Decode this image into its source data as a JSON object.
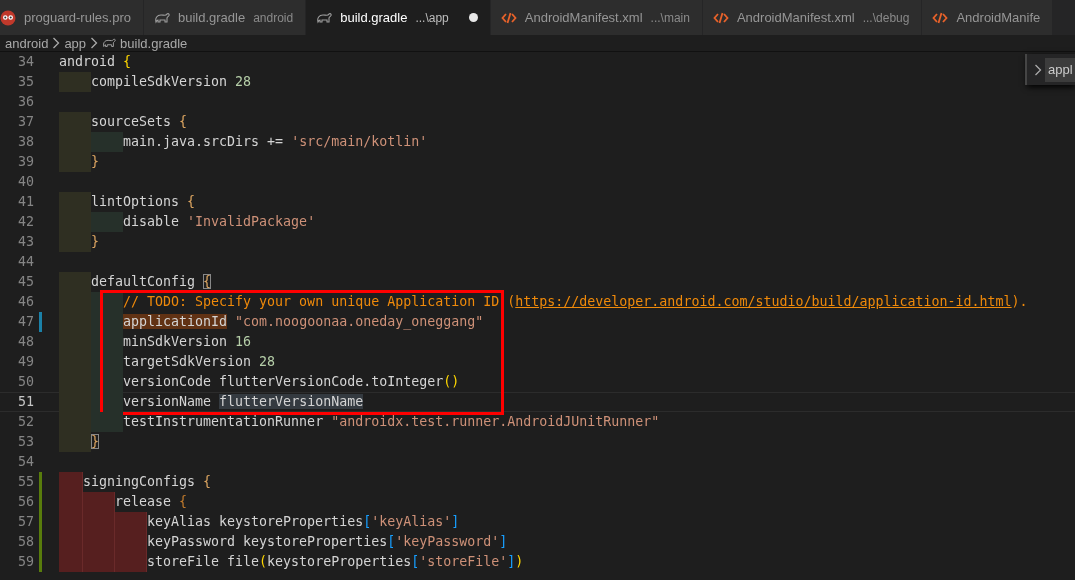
{
  "tabs": [
    {
      "label": "proguard-rules.pro",
      "kind": "proguard",
      "selected": false,
      "dirty": false
    },
    {
      "label": "build.gradle",
      "description": "android",
      "kind": "gradle",
      "selected": false,
      "dirty": false
    },
    {
      "label": "build.gradle",
      "description": "...\\app",
      "kind": "gradle",
      "selected": true,
      "dirty": true
    },
    {
      "label": "AndroidManifest.xml",
      "description": "...\\main",
      "kind": "markup",
      "selected": false,
      "dirty": false
    },
    {
      "label": "AndroidManifest.xml",
      "description": "...\\debug",
      "kind": "markup",
      "selected": false,
      "dirty": false
    },
    {
      "label": "AndroidManife",
      "kind": "markup",
      "selected": false,
      "dirty": false
    }
  ],
  "breadcrumb": [
    {
      "label": "android",
      "kind": "folder"
    },
    {
      "label": "app",
      "kind": "folder"
    },
    {
      "label": "build.gradle",
      "kind": "gradle"
    }
  ],
  "find_widget": {
    "value": "appl"
  },
  "lines": [
    {
      "number": "34",
      "current": false,
      "modified": false,
      "added": false,
      "boxed": false,
      "tokens": [
        {
          "text": "android ",
          "kind": "plain"
        },
        {
          "text": "{",
          "kind": "bracket1"
        }
      ]
    },
    {
      "number": "35",
      "current": false,
      "modified": false,
      "added": false,
      "boxed": false,
      "guides": [
        {
          "kind": "level1"
        }
      ],
      "tokens": [
        {
          "text": "compileSdkVersion ",
          "kind": "plain"
        },
        {
          "text": "28",
          "kind": "num"
        }
      ]
    },
    {
      "number": "36",
      "current": false,
      "modified": false,
      "added": false,
      "boxed": false
    },
    {
      "number": "37",
      "current": false,
      "modified": false,
      "added": false,
      "boxed": false,
      "guides": [
        {
          "kind": "level1"
        }
      ],
      "tokens": [
        {
          "text": "sourceSets ",
          "kind": "plain"
        },
        {
          "text": "{",
          "kind": "bracket2"
        }
      ]
    },
    {
      "number": "38",
      "current": false,
      "modified": false,
      "added": false,
      "boxed": false,
      "guides": [
        {
          "kind": "level1"
        },
        {
          "kind": "level2"
        }
      ],
      "tokens": [
        {
          "text": "main.java.srcDirs += ",
          "kind": "plain"
        },
        {
          "text": "'src/main/kotlin'",
          "kind": "str"
        }
      ]
    },
    {
      "number": "39",
      "current": false,
      "modified": false,
      "added": false,
      "boxed": false,
      "guides": [
        {
          "kind": "level1"
        }
      ],
      "tokens": [
        {
          "text": "}",
          "kind": "bracket2"
        }
      ]
    },
    {
      "number": "40",
      "current": false,
      "modified": false,
      "added": false,
      "boxed": false
    },
    {
      "number": "41",
      "current": false,
      "modified": false,
      "added": false,
      "boxed": false,
      "guides": [
        {
          "kind": "level1"
        }
      ],
      "tokens": [
        {
          "text": "lintOptions ",
          "kind": "plain"
        },
        {
          "text": "{",
          "kind": "bracket2"
        }
      ]
    },
    {
      "number": "42",
      "current": false,
      "modified": false,
      "added": false,
      "boxed": false,
      "guides": [
        {
          "kind": "level1"
        },
        {
          "kind": "level2"
        }
      ],
      "tokens": [
        {
          "text": "disable ",
          "kind": "plain"
        },
        {
          "text": "'InvalidPackage'",
          "kind": "str"
        }
      ]
    },
    {
      "number": "43",
      "current": false,
      "modified": false,
      "added": false,
      "boxed": false,
      "guides": [
        {
          "kind": "level1"
        }
      ],
      "tokens": [
        {
          "text": "}",
          "kind": "bracket2"
        }
      ]
    },
    {
      "number": "44",
      "current": false,
      "modified": false,
      "added": false,
      "boxed": false
    },
    {
      "number": "45",
      "current": false,
      "modified": false,
      "added": false,
      "boxed": false,
      "guides": [
        {
          "kind": "level1"
        }
      ],
      "tokens": [
        {
          "text": "defaultConfig ",
          "kind": "plain"
        },
        {
          "text": "{",
          "kind": "bracket2-match"
        }
      ]
    },
    {
      "number": "46",
      "current": false,
      "modified": false,
      "added": false,
      "boxed": true,
      "guides": [
        {
          "kind": "level1"
        },
        {
          "kind": "level2"
        }
      ],
      "tokens": [
        {
          "text": "// TODO: Specify your own unique Application ID (",
          "kind": "comment"
        },
        {
          "text": "https://developer.android.com/studio/build/application-id.html",
          "kind": "link"
        },
        {
          "text": ").",
          "kind": "comment"
        }
      ]
    },
    {
      "number": "47",
      "current": false,
      "modified": true,
      "added": false,
      "boxed": true,
      "guides": [
        {
          "kind": "level1"
        },
        {
          "kind": "level2"
        }
      ],
      "tokens": [
        {
          "text": "applicationId",
          "kind": "occurrence"
        },
        {
          "text": " \"com.noogoonaa.oneday_oneggang\"",
          "kind": "str"
        }
      ]
    },
    {
      "number": "48",
      "current": false,
      "modified": false,
      "added": false,
      "boxed": true,
      "guides": [
        {
          "kind": "level1"
        },
        {
          "kind": "level2"
        }
      ],
      "tokens": [
        {
          "text": "minSdkVersion ",
          "kind": "plain"
        },
        {
          "text": "16",
          "kind": "num"
        }
      ]
    },
    {
      "number": "49",
      "current": false,
      "modified": false,
      "added": false,
      "boxed": true,
      "guides": [
        {
          "kind": "level1"
        },
        {
          "kind": "level2"
        }
      ],
      "tokens": [
        {
          "text": "targetSdkVersion ",
          "kind": "plain"
        },
        {
          "text": "28",
          "kind": "num"
        }
      ]
    },
    {
      "number": "50",
      "current": false,
      "modified": false,
      "added": false,
      "boxed": true,
      "guides": [
        {
          "kind": "level1"
        },
        {
          "kind": "level2"
        }
      ],
      "tokens": [
        {
          "text": "versionCode flutterVersionCode.toInteger",
          "kind": "plain"
        },
        {
          "text": "()",
          "kind": "bracket1"
        }
      ]
    },
    {
      "number": "51",
      "current": true,
      "modified": false,
      "added": false,
      "boxed": true,
      "guides": [
        {
          "kind": "level1"
        },
        {
          "kind": "level2"
        }
      ],
      "tokens": [
        {
          "text": "versionName ",
          "kind": "plain"
        },
        {
          "text": "flutterVersionName",
          "kind": "selection"
        }
      ]
    },
    {
      "number": "52",
      "current": false,
      "modified": false,
      "added": false,
      "boxed": false,
      "guides": [
        {
          "kind": "level1"
        },
        {
          "kind": "level2"
        }
      ],
      "tokens": [
        {
          "text": "testInstrumentationRunner ",
          "kind": "plain"
        },
        {
          "text": "\"androidx.test.runner.AndroidJUnitRunner\"",
          "kind": "str"
        }
      ]
    },
    {
      "number": "53",
      "current": false,
      "modified": false,
      "added": false,
      "boxed": false,
      "guides": [
        {
          "kind": "level1"
        }
      ],
      "tokens": [
        {
          "text": "}",
          "kind": "bracket2-match"
        }
      ]
    },
    {
      "number": "54",
      "current": false,
      "modified": false,
      "added": false,
      "boxed": false
    },
    {
      "number": "55",
      "current": false,
      "modified": false,
      "added": true,
      "boxed": false,
      "guides": [
        {
          "kind": "error-short"
        }
      ],
      "tokens": [
        {
          "text": "signingConfigs ",
          "kind": "plain"
        },
        {
          "text": "{",
          "kind": "bracket2"
        }
      ]
    },
    {
      "number": "56",
      "current": false,
      "modified": false,
      "added": true,
      "boxed": false,
      "guides": [
        {
          "kind": "error-short"
        },
        {
          "kind": "error"
        }
      ],
      "tokens": [
        {
          "text": "release ",
          "kind": "plain"
        },
        {
          "text": "{",
          "kind": "bracket3"
        }
      ]
    },
    {
      "number": "57",
      "current": false,
      "modified": false,
      "added": true,
      "boxed": false,
      "guides": [
        {
          "kind": "error-short"
        },
        {
          "kind": "error"
        },
        {
          "kind": "error"
        }
      ],
      "tokens": [
        {
          "text": "keyAlias keystoreProperties",
          "kind": "plain"
        },
        {
          "text": "[",
          "kind": "bracket4"
        },
        {
          "text": "'keyAlias'",
          "kind": "str"
        },
        {
          "text": "]",
          "kind": "bracket4"
        }
      ]
    },
    {
      "number": "58",
      "current": false,
      "modified": false,
      "added": true,
      "boxed": false,
      "guides": [
        {
          "kind": "error-short"
        },
        {
          "kind": "error"
        },
        {
          "kind": "error"
        }
      ],
      "tokens": [
        {
          "text": "keyPassword keystoreProperties",
          "kind": "plain"
        },
        {
          "text": "[",
          "kind": "bracket4"
        },
        {
          "text": "'keyPassword'",
          "kind": "str"
        },
        {
          "text": "]",
          "kind": "bracket4"
        }
      ]
    },
    {
      "number": "59",
      "current": false,
      "modified": false,
      "added": true,
      "boxed": false,
      "guides": [
        {
          "kind": "error-short"
        },
        {
          "kind": "error"
        },
        {
          "kind": "error"
        }
      ],
      "tokens": [
        {
          "text": "storeFile file",
          "kind": "plain"
        },
        {
          "text": "(",
          "kind": "bracket1"
        },
        {
          "text": "keystoreProperties",
          "kind": "plain"
        },
        {
          "text": "[",
          "kind": "bracket4"
        },
        {
          "text": "'storeFile'",
          "kind": "str"
        },
        {
          "text": "]",
          "kind": "bracket4"
        },
        {
          "text": ")",
          "kind": "bracket1"
        }
      ]
    }
  ]
}
